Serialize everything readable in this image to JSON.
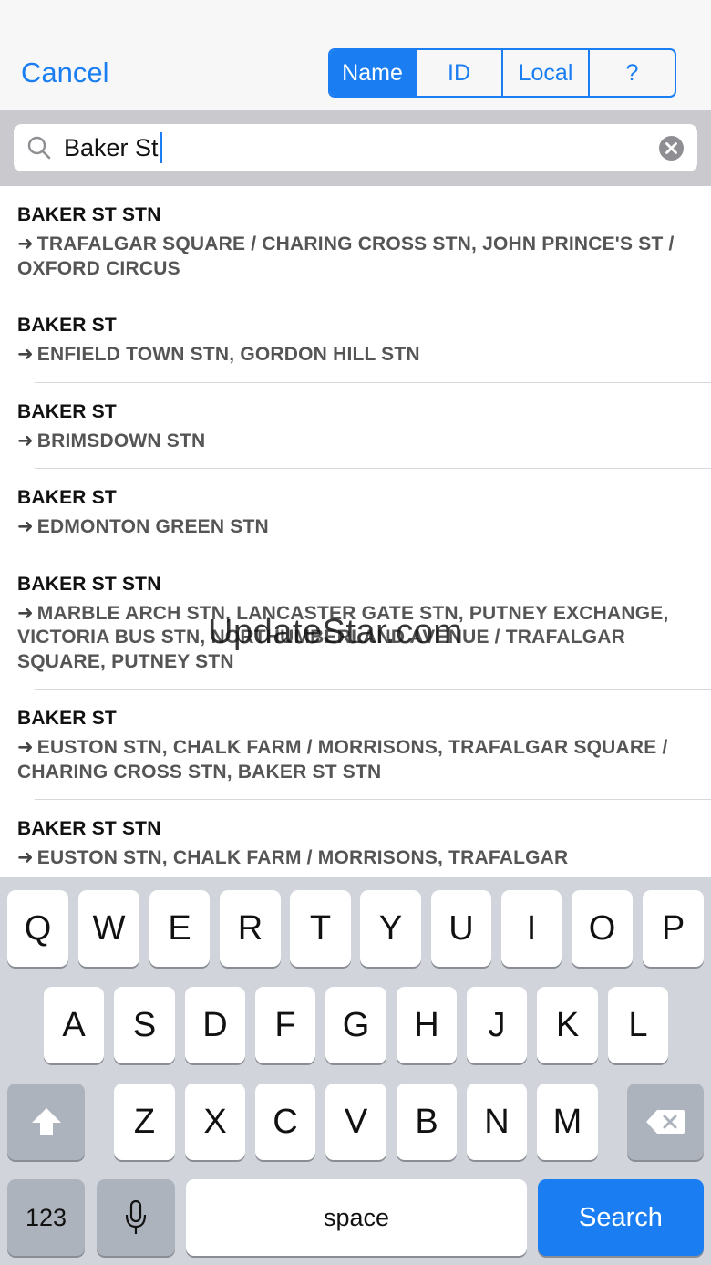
{
  "navbar": {
    "cancel_label": "Cancel",
    "segments": [
      {
        "label": "Name",
        "selected": true
      },
      {
        "label": "ID",
        "selected": false
      },
      {
        "label": "Local",
        "selected": false
      },
      {
        "label": "?",
        "selected": false
      }
    ]
  },
  "search": {
    "value": "Baker St",
    "icon": "magnifier-icon",
    "clear_icon": "clear-circle-x-icon"
  },
  "results": [
    {
      "title": "BAKER ST STN",
      "destinations": "TRAFALGAR SQUARE / CHARING CROSS STN, JOHN PRINCE'S ST / OXFORD CIRCUS"
    },
    {
      "title": "BAKER ST",
      "destinations": "ENFIELD TOWN STN, GORDON HILL STN"
    },
    {
      "title": "BAKER ST",
      "destinations": "BRIMSDOWN STN"
    },
    {
      "title": "BAKER ST",
      "destinations": "EDMONTON GREEN STN"
    },
    {
      "title": "BAKER ST STN",
      "destinations": "MARBLE ARCH STN, LANCASTER GATE STN, PUTNEY EXCHANGE, VICTORIA BUS STN, NORTHUMBERLAND AVENUE / TRAFALGAR SQUARE, PUTNEY STN"
    },
    {
      "title": "BAKER ST",
      "destinations": "EUSTON STN, CHALK FARM / MORRISONS, TRAFALGAR SQUARE / CHARING CROSS STN, BAKER ST STN"
    },
    {
      "title": "BAKER ST STN",
      "destinations": "EUSTON STN, CHALK FARM / MORRISONS, TRAFALGAR"
    }
  ],
  "arrow_glyph": "➜",
  "watermark": "UpdateStar.com",
  "keyboard": {
    "row1": [
      "Q",
      "W",
      "E",
      "R",
      "T",
      "Y",
      "U",
      "I",
      "O",
      "P"
    ],
    "row2": [
      "A",
      "S",
      "D",
      "F",
      "G",
      "H",
      "J",
      "K",
      "L"
    ],
    "row3": [
      "Z",
      "X",
      "C",
      "V",
      "B",
      "N",
      "M"
    ],
    "shift_icon": "shift-arrow-icon",
    "backspace_icon": "backspace-icon",
    "numbers_label": "123",
    "mic_icon": "microphone-icon",
    "space_label": "space",
    "search_label": "Search"
  },
  "colors": {
    "accent": "#1a7ef2",
    "navbar_bg": "#f7f7f7",
    "searchbar_bg": "#c9c9ce",
    "keyboard_bg": "#d1d5db",
    "dark_key": "#adb3bc"
  }
}
